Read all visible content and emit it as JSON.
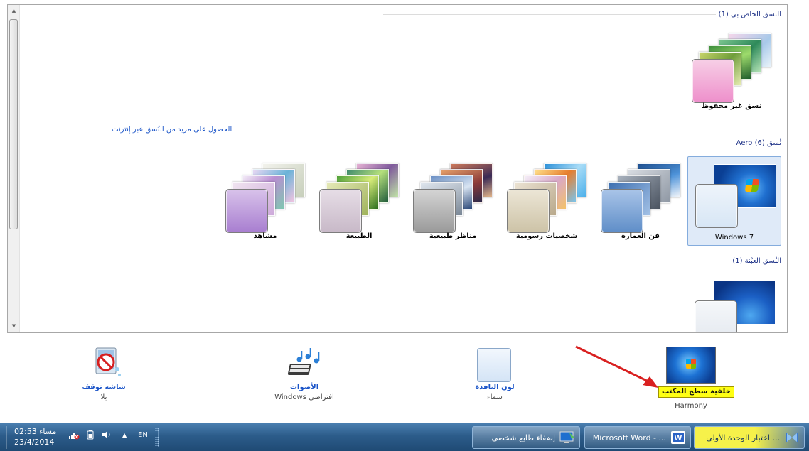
{
  "theme_groups": {
    "my_themes": {
      "title": "النسق الخاص بي (1)",
      "themes": [
        {
          "label": "نسق غير محفوظ"
        }
      ]
    },
    "online_link": "الحصول على مزيد من النُسق عبر إنترنت",
    "aero_themes": {
      "title": "نُسق Aero (6)",
      "themes": [
        {
          "label": "Windows 7",
          "selected": true
        },
        {
          "label": "فن العمارة"
        },
        {
          "label": "شخصيات رسومية"
        },
        {
          "label": "مناظر طبيعية"
        },
        {
          "label": "الطبيعة"
        },
        {
          "label": "مشاهد"
        }
      ]
    },
    "basic_themes": {
      "title": "النُسق العَبْنة (1)"
    }
  },
  "settings": {
    "desktop_background": {
      "title": "خلفية سطح المكتب",
      "value": "Harmony"
    },
    "window_color": {
      "title": "لون النافذة",
      "value": "سماء"
    },
    "sounds": {
      "title": "الأصوات",
      "value": "افتراضي Windows"
    },
    "screen_saver": {
      "title": "شاشة توقف",
      "value": "بلا"
    }
  },
  "tooltip": "خلفية سطح المكتب",
  "taskbar": {
    "buttons": [
      {
        "label": "اختبار الوحدة الأولى ..."
      },
      {
        "label": "Microsoft Word - ..."
      },
      {
        "label": "إضفاء طابع شخصي"
      }
    ],
    "language": "EN",
    "tray_arrow": "▲",
    "clock_time": "02:53 مساء",
    "clock_date": "23/4/2014"
  },
  "colors": {
    "link": "#1a54c8",
    "group_title": "#1e3287",
    "selection_fill": "#dfeaf8",
    "selection_border": "#84acdd",
    "taskbar": "#2c5c8a",
    "tooltip": "#ffff14",
    "arrow": "#d92020"
  },
  "icons": {
    "scroll_up": "scroll-up-arrow-icon",
    "scroll_down": "scroll-down-arrow-icon",
    "start": "start-orb-icon",
    "word": "word-icon",
    "personalize": "personalize-icon",
    "network": "network-icon",
    "power": "battery-icon",
    "volume": "volume-icon"
  }
}
